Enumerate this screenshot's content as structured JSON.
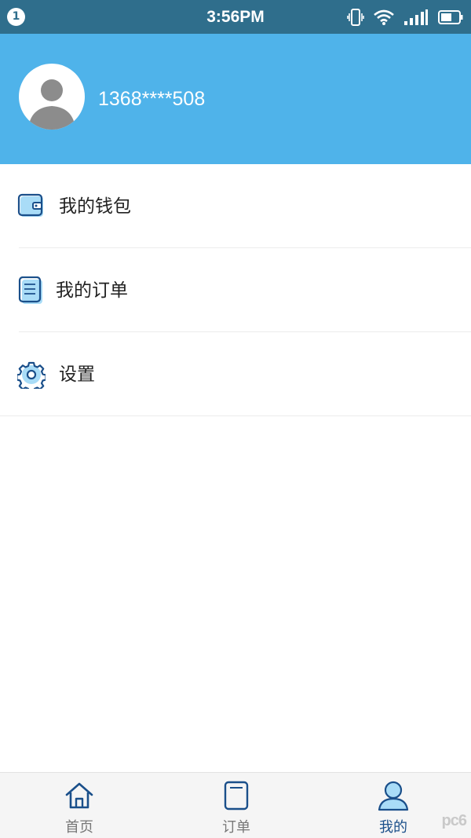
{
  "status_bar": {
    "notification_count": "1",
    "time": "3:56PM",
    "icons": [
      "vibrate-icon",
      "wifi-icon",
      "signal-icon",
      "battery-icon"
    ]
  },
  "profile": {
    "avatar_icon": "default-user-avatar-icon",
    "phone": "1368****508"
  },
  "menu": {
    "items": [
      {
        "label": "我的钱包",
        "icon": "wallet-icon"
      },
      {
        "label": "我的订单",
        "icon": "order-list-icon"
      },
      {
        "label": "设置",
        "icon": "gear-icon"
      }
    ]
  },
  "tabbar": {
    "tabs": [
      {
        "label": "首页",
        "icon": "home-icon",
        "active": false
      },
      {
        "label": "订单",
        "icon": "clipboard-icon",
        "active": false
      },
      {
        "label": "我的",
        "icon": "user-icon",
        "active": true
      }
    ]
  },
  "watermark": {
    "text": "pc6"
  },
  "colors": {
    "status_bar": "#2f6e8c",
    "header": "#4fb3ea",
    "icon_blue": "#1a4f8a",
    "icon_fill": "#a9dcf7",
    "tab_active": "#1a4f8a"
  }
}
